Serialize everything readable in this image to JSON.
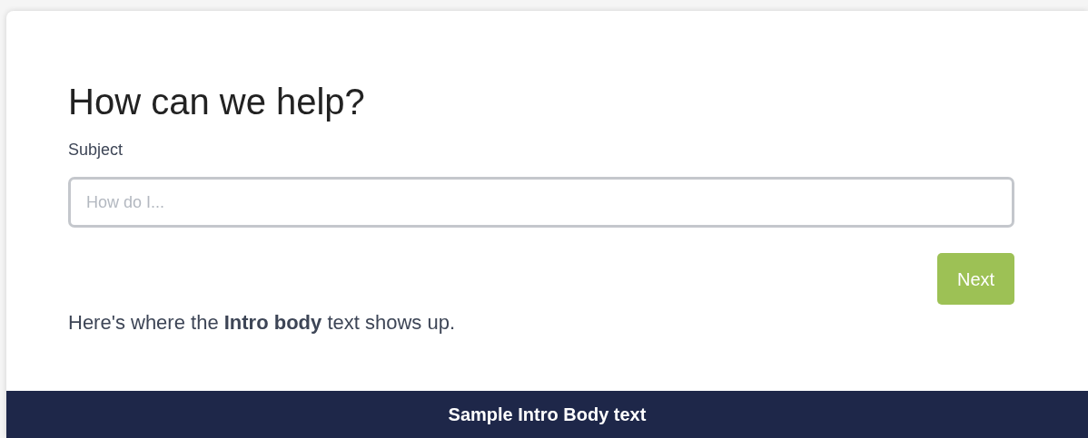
{
  "title": "How can we help?",
  "subject": {
    "label": "Subject",
    "placeholder": "How do I..."
  },
  "next_button": "Next",
  "intro": "Here's where the **Intro body** text shows up.",
  "footer": "Sample Intro Body text"
}
